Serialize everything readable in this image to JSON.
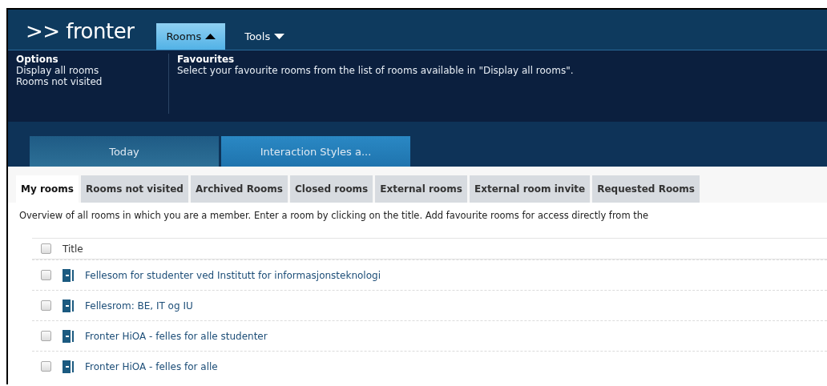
{
  "header": {
    "logo": ">> fronter",
    "menus": [
      {
        "label": "Rooms",
        "expanded": true
      },
      {
        "label": "Tools",
        "expanded": false
      }
    ]
  },
  "menu_panel": {
    "sections": [
      {
        "heading": "Options",
        "items": [
          "Display all rooms",
          "Rooms not visited"
        ]
      },
      {
        "heading": "Favourites",
        "items": [
          "Select your favourite rooms from the list of rooms available in \"Display all rooms\"."
        ]
      }
    ]
  },
  "room_tabs": [
    {
      "label": "Today",
      "selected": false
    },
    {
      "label": "Interaction Styles a...",
      "selected": true
    }
  ],
  "tabs": [
    {
      "label": "My rooms",
      "selected": true
    },
    {
      "label": "Rooms not visited",
      "selected": false
    },
    {
      "label": "Archived Rooms",
      "selected": false
    },
    {
      "label": "Closed rooms",
      "selected": false
    },
    {
      "label": "External rooms",
      "selected": false
    },
    {
      "label": "External room invite",
      "selected": false
    },
    {
      "label": "Requested Rooms",
      "selected": false
    }
  ],
  "description": "Overview of all rooms in which you are a member. Enter a room by clicking on the title. Add favourite rooms for access directly from the",
  "table": {
    "columns": [
      "Title"
    ],
    "header_checked": false,
    "rows": [
      {
        "title": "Fellesom for studenter ved Institutt for informasjonsteknologi",
        "checked": false
      },
      {
        "title": "Fellesrom: BE, IT og IU",
        "checked": false
      },
      {
        "title": "Fronter HiOA - felles for alle studenter",
        "checked": false
      },
      {
        "title": "Fronter HiOA - felles for alle",
        "checked": false
      }
    ]
  }
}
